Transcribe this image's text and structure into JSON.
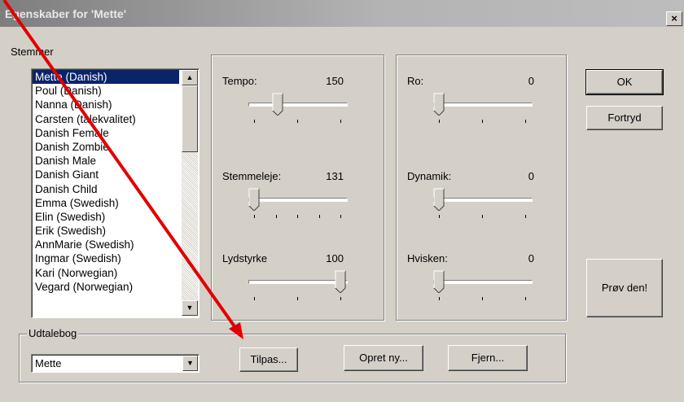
{
  "window": {
    "title": "Egenskaber for 'Mette'",
    "close_glyph": "×"
  },
  "voices": {
    "label": "Stemmer",
    "items": [
      "Mette (Danish)",
      "Poul (Danish)",
      "Nanna (Danish)",
      "Carsten (talekvalitet)",
      "Danish Female",
      "Danish Zombie",
      "Danish Male",
      "Danish Giant",
      "Danish Child",
      "Emma (Swedish)",
      "Elin (Swedish)",
      "Erik (Swedish)",
      "AnnMarie (Swedish)",
      "Ingmar (Swedish)",
      "Kari (Norwegian)",
      "Vegard (Norwegian)"
    ],
    "selected_index": 0
  },
  "sliders_left": [
    {
      "label": "Tempo:",
      "value": "150",
      "position": 0.27
    },
    {
      "label": "Stemmeleje:",
      "value": "131",
      "position": 0.0
    },
    {
      "label": "Lydstyrke",
      "value": "100",
      "position": 1.0
    }
  ],
  "sliders_right": [
    {
      "label": "Ro:",
      "value": "0",
      "position": 0.0
    },
    {
      "label": "Dynamik:",
      "value": "0",
      "position": 0.0
    },
    {
      "label": "Hvisken:",
      "value": "0",
      "position": 0.0
    }
  ],
  "buttons": {
    "ok": "OK",
    "cancel": "Fortryd",
    "try": "Prøv den!"
  },
  "dictionary": {
    "label": "Udtalebog",
    "selected": "Mette",
    "customize": "Tilpas...",
    "create_new": "Opret ny...",
    "remove": "Fjern..."
  },
  "annotation": {
    "color": "#e00000"
  }
}
